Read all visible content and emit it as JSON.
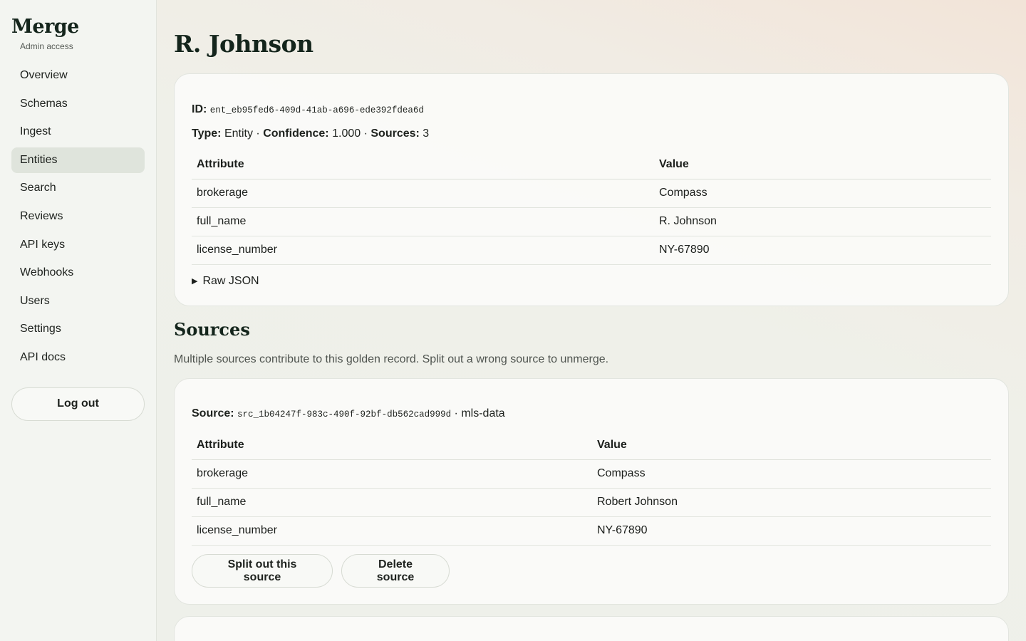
{
  "sidebar": {
    "brand": "Merge",
    "subtitle": "Admin access",
    "items": [
      {
        "label": "Overview"
      },
      {
        "label": "Schemas"
      },
      {
        "label": "Ingest"
      },
      {
        "label": "Entities",
        "active": true
      },
      {
        "label": "Search"
      },
      {
        "label": "Reviews"
      },
      {
        "label": "API keys"
      },
      {
        "label": "Webhooks"
      },
      {
        "label": "Users"
      },
      {
        "label": "Settings"
      },
      {
        "label": "API docs"
      }
    ],
    "logout_label": "Log out"
  },
  "entity": {
    "title": "R. Johnson",
    "id_label": "ID:",
    "id_value": "ent_eb95fed6-409d-41ab-a696-ede392fdea6d",
    "type_label": "Type:",
    "type_value": "Entity",
    "confidence_label": "Confidence:",
    "confidence_value": "1.000",
    "sources_label": "Sources:",
    "sources_value": "3",
    "separator": "·",
    "table": {
      "headers": [
        "Attribute",
        "Value"
      ],
      "rows": [
        [
          "brokerage",
          "Compass"
        ],
        [
          "full_name",
          "R. Johnson"
        ],
        [
          "license_number",
          "NY-67890"
        ]
      ]
    },
    "raw_json_label": "Raw JSON"
  },
  "sources_section": {
    "title": "Sources",
    "description": "Multiple sources contribute to this golden record. Split out a wrong source to unmerge.",
    "sources": [
      {
        "source_label": "Source:",
        "source_id": "src_1b04247f-983c-490f-92bf-db562cad999d",
        "source_system": "mls-data",
        "table": {
          "headers": [
            "Attribute",
            "Value"
          ],
          "rows": [
            [
              "brokerage",
              "Compass"
            ],
            [
              "full_name",
              "Robert Johnson"
            ],
            [
              "license_number",
              "NY-67890"
            ]
          ]
        },
        "split_label": "Split out this source",
        "delete_label": "Delete source"
      }
    ]
  }
}
